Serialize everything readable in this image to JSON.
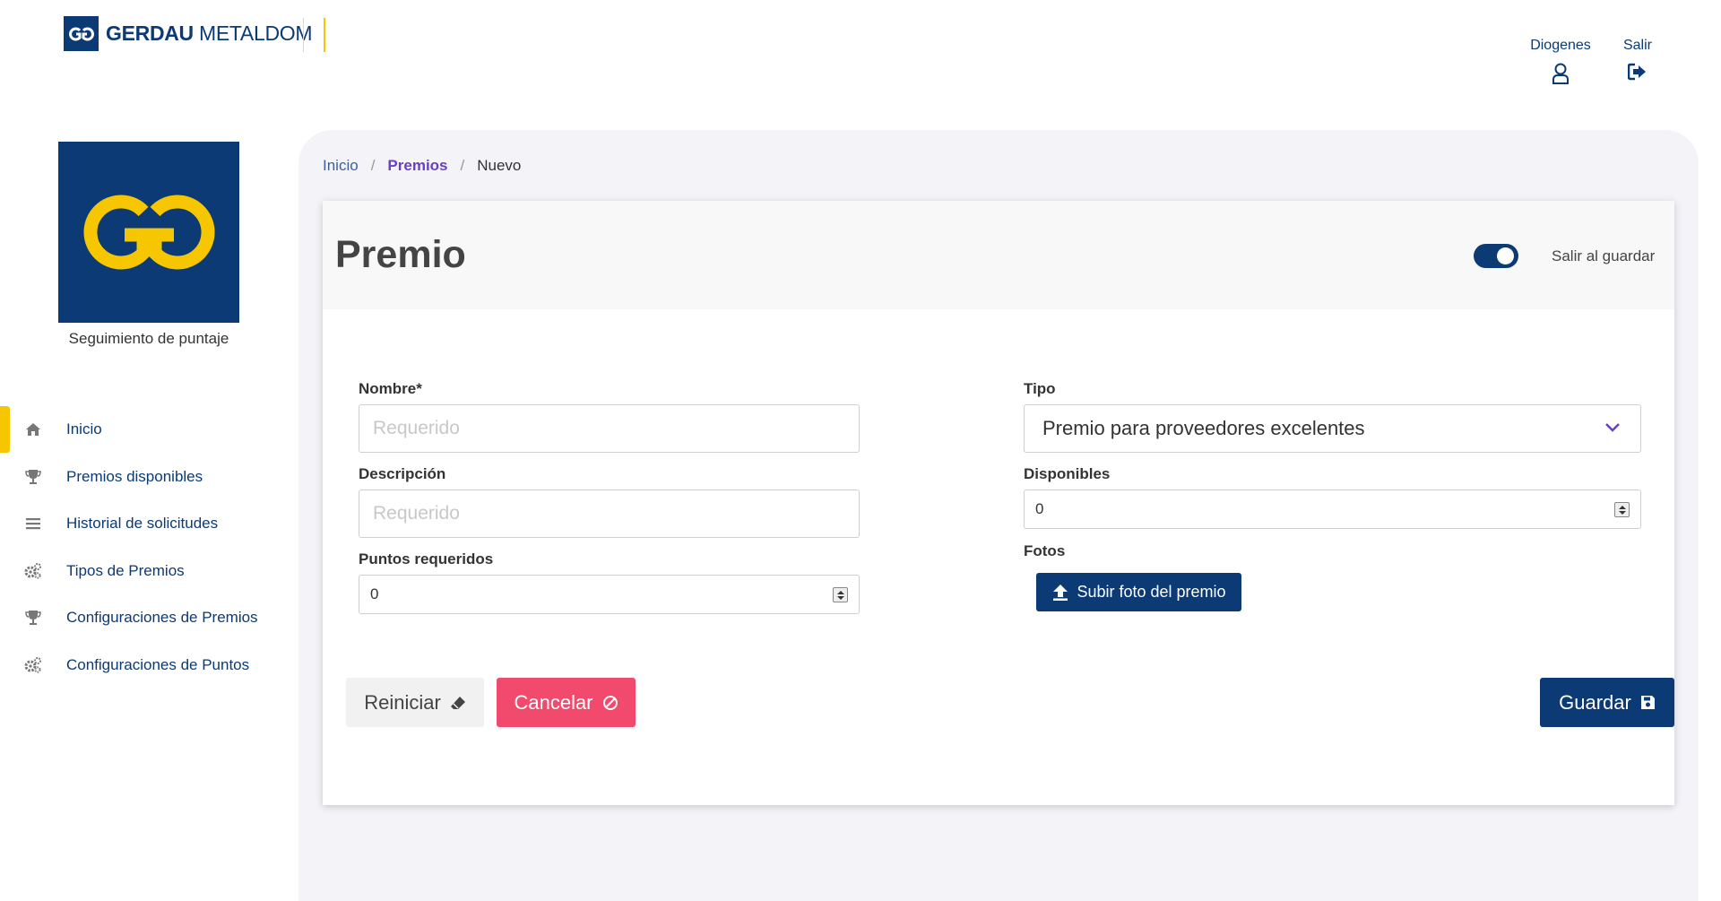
{
  "header": {
    "brand_strong": "GERDAU",
    "brand_light": "METALDOM",
    "user_label": "Diogenes",
    "exit_label": "Salir"
  },
  "sidebar": {
    "caption": "Seguimiento de puntaje",
    "items": [
      {
        "label": "Inicio",
        "icon": "home-icon",
        "active": true
      },
      {
        "label": "Premios disponibles",
        "icon": "trophy-icon"
      },
      {
        "label": "Historial de solicitudes",
        "icon": "list-icon"
      },
      {
        "label": "Tipos de Premios",
        "icon": "gears-icon"
      },
      {
        "label": "Configuraciones de Premios",
        "icon": "trophy-icon"
      },
      {
        "label": "Configuraciones de Puntos",
        "icon": "gears-icon"
      }
    ]
  },
  "breadcrumb": {
    "home": "Inicio",
    "section": "Premios",
    "current": "Nuevo",
    "separator": "/"
  },
  "form": {
    "title": "Premio",
    "exit_on_save_label": "Salir al guardar",
    "exit_on_save": true,
    "nombre": {
      "label": "Nombre*",
      "placeholder": "Requerido",
      "value": ""
    },
    "descripcion": {
      "label": "Descripción",
      "placeholder": "Requerido",
      "value": ""
    },
    "puntos": {
      "label": "Puntos requeridos",
      "value": "0"
    },
    "tipo": {
      "label": "Tipo",
      "value": "Premio para proveedores excelentes"
    },
    "disponibles": {
      "label": "Disponibles",
      "value": "0"
    },
    "fotos": {
      "label": "Fotos",
      "upload_label": "Subir foto del premio"
    },
    "buttons": {
      "reset": "Reiniciar",
      "cancel": "Cancelar",
      "save": "Guardar"
    }
  },
  "colors": {
    "brand_blue": "#0b3a75",
    "brand_yellow": "#f6c700",
    "cancel_red": "#f24a6d",
    "breadcrumb_active": "#6a3fc4"
  }
}
